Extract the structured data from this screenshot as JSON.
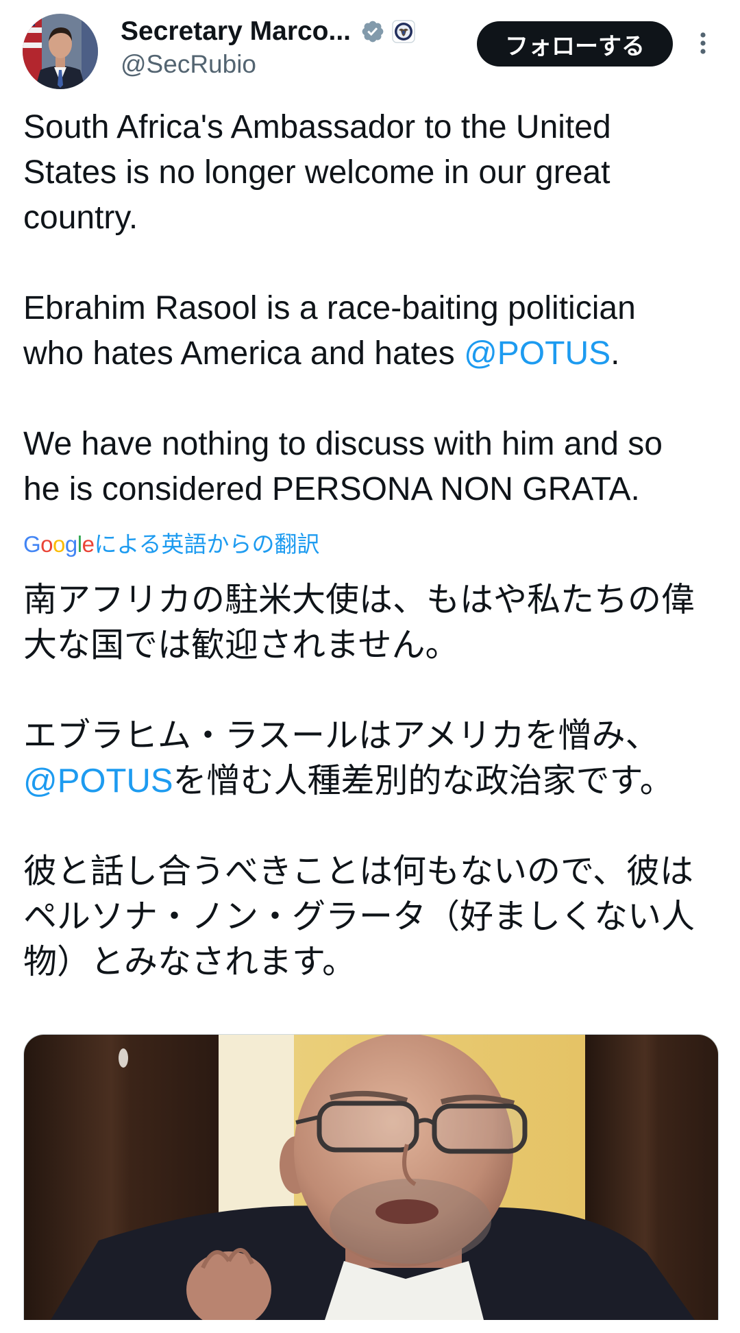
{
  "header": {
    "author_name": "Secretary Marco...",
    "author_handle": "@SecRubio",
    "follow_label": "フォローする"
  },
  "icons": {
    "avatar": "profile-avatar-image",
    "verified": "verified-badge-icon",
    "affiliation": "department-of-state-seal-icon",
    "more": "more-options-icon"
  },
  "tweet": {
    "original": {
      "p1": [
        "South Africa's Ambassador to the United",
        "States is no longer welcome in our great",
        "country."
      ],
      "p2_line1": "Ebrahim Rasool is a race-baiting politician",
      "p2_line2_before": "who hates America and hates ",
      "p2_mention": "@POTUS",
      "p2_line2_after": ".",
      "p3": [
        "We have nothing to discuss with him and so",
        "he is considered PERSONA NON GRATA."
      ]
    },
    "translation_label": {
      "provider": "Google",
      "text": "による英語からの翻訳"
    },
    "translated": {
      "p1": [
        "南アフリカの駐米大使は、もはや私たちの偉",
        "大な国では歓迎されません。"
      ],
      "p2_line1": "エブラヒム・ラスールはアメリカを憎み、",
      "p2_mention": "@POTUS",
      "p2_line2_after": "を憎む人種差別的な政治家です。",
      "p3": [
        "彼と話し合うべきことは何もないので、彼は",
        "ペルソナ・ノン・グラータ（好ましくない人",
        "物）とみなされます。"
      ]
    }
  },
  "colors": {
    "text": "#0f1419",
    "secondary": "#536471",
    "link": "#1d9bf0",
    "follow_bg": "#0f1419",
    "follow_text": "#ffffff",
    "verified": "#829aab",
    "google_letters": [
      "#4285F4",
      "#EA4335",
      "#FBBC05",
      "#4285F4",
      "#34A853",
      "#EA4335"
    ]
  }
}
